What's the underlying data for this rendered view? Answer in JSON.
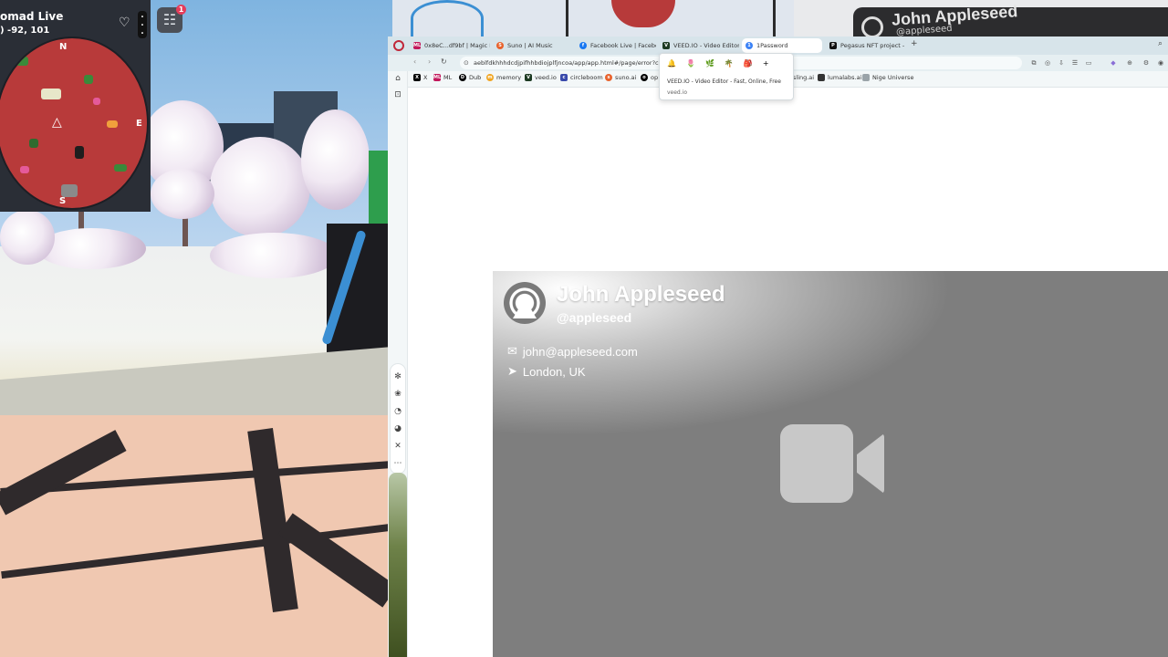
{
  "game": {
    "title": "omad Live",
    "coords": ") -92, 101",
    "inventory_badge": "1",
    "compass": {
      "n": "N",
      "e": "E",
      "s": "S"
    },
    "heart_icon": "heart-icon",
    "menu_icon": "dots-vertical-icon"
  },
  "browser": {
    "tabs": [
      {
        "label": "0x8eC...df9bf | Magic Lab",
        "color": "#c2185b",
        "glyph": "ML"
      },
      {
        "label": "Suno | AI Music",
        "color": "#e8622c",
        "glyph": "S"
      },
      {
        "label": "Facebook Live | Facebook",
        "color": "#1877f2",
        "glyph": "f"
      },
      {
        "label": "VEED.IO - Video Editor",
        "color": "#1c3a22",
        "glyph": "V"
      },
      {
        "label": "1Password",
        "color": "#3b82f6",
        "glyph": "1"
      },
      {
        "label": "Pegasus NFT project - v",
        "color": "#111111",
        "glyph": "P"
      }
    ],
    "active_tab": 4,
    "url": "aeblfdkhhhdcdjpifhhbdiojplfjncoa/app/app.html#/page/error?cod",
    "bookmarks": [
      {
        "label": "X",
        "color": "#000000",
        "glyph": "X"
      },
      {
        "label": "ML",
        "color": "#c2185b",
        "glyph": "ML"
      },
      {
        "label": "Dub",
        "color": "#000000",
        "glyph": "D"
      },
      {
        "label": "memory",
        "color": "#f1a521",
        "glyph": "m"
      },
      {
        "label": "veed.io",
        "color": "#1c3a22",
        "glyph": "V"
      },
      {
        "label": "circleboom",
        "color": "#3949ab",
        "glyph": "c"
      },
      {
        "label": "suno.ai",
        "color": "#e8622c",
        "glyph": "s"
      },
      {
        "label": "op",
        "color": "#000000",
        "glyph": "o"
      }
    ],
    "bookmarks_right": [
      {
        "label": "sling.ai"
      },
      {
        "label": "lumalabs.ai"
      },
      {
        "label": "Nige Universe"
      }
    ],
    "popup": {
      "title": "VEED.IO - Video Editor - Fast, Online, Free",
      "url": "veed.io"
    }
  },
  "card": {
    "name": "John Appleseed",
    "handle": "@appleseed",
    "email": "john@appleseed.com",
    "location": "London, UK",
    "camera_icon": "video-camera-off-icon"
  },
  "background": {
    "name": "John Appleseed",
    "handle": "@appleseed"
  }
}
